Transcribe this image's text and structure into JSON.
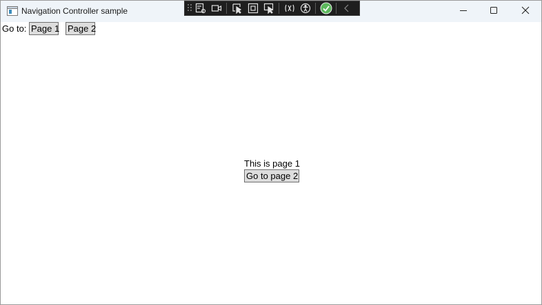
{
  "window": {
    "title": "Navigation Controller sample",
    "icons": {
      "app": "app-window-icon",
      "minimize": "minimize-icon",
      "maximize": "maximize-icon",
      "close": "close-icon"
    }
  },
  "debug_toolbar": {
    "tools": [
      "live-visual-tree-icon",
      "video-record-icon",
      "select-element-icon",
      "display-layout-adorners-icon",
      "track-focused-element-icon",
      "hot-reload-icon",
      "accessibility-icon",
      "binding-success-icon",
      "collapse-chevron-icon"
    ]
  },
  "nav": {
    "goto_label": "Go to:",
    "page1_label": "Page 1",
    "page2_label": "Page 2"
  },
  "content": {
    "page_text": "This is page 1",
    "goto_page2_label": "Go to page 2"
  }
}
